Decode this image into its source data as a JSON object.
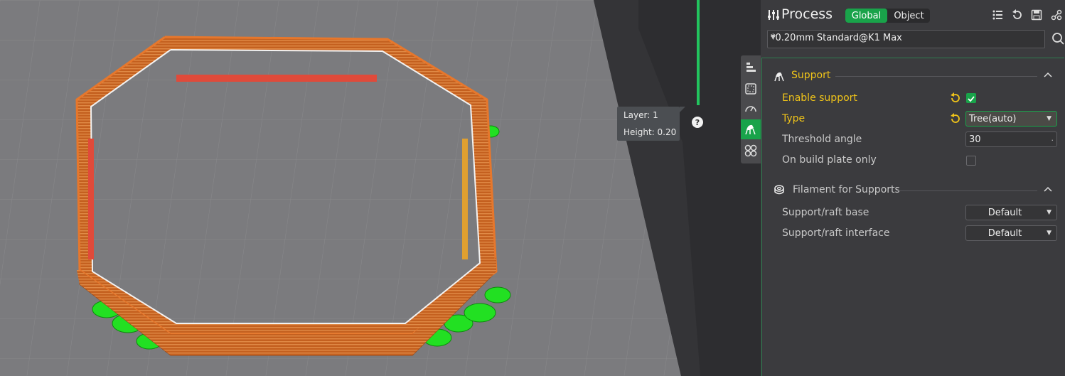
{
  "viewport": {
    "layer_label": "Layer: 1",
    "height_label": "Height: 0.20",
    "help_label": "?"
  },
  "sidetabs": [
    {
      "icon": "quality-icon"
    },
    {
      "icon": "strength-icon"
    },
    {
      "icon": "speed-icon"
    },
    {
      "icon": "support-icon",
      "active": true
    },
    {
      "icon": "others-icon"
    }
  ],
  "panel": {
    "title": "Process",
    "mode_global": "Global",
    "mode_object": "Object",
    "preset": "*0.20mm Standard@K1 Max",
    "sections": {
      "support": {
        "title": "Support",
        "enable_support_label": "Enable support",
        "type_label": "Type",
        "type_value": "Tree(auto)",
        "threshold_label": "Threshold angle",
        "threshold_value": "30",
        "threshold_unit": ".",
        "build_plate_label": "On build plate only"
      },
      "filament": {
        "title": "Filament for Supports",
        "base_label": "Support/raft base",
        "base_value": "Default",
        "interface_label": "Support/raft interface",
        "interface_value": "Default"
      }
    }
  },
  "colors": {
    "accent": "#19a34a",
    "changed": "#f0c419",
    "model": "#cf6a24",
    "support": "#22e022"
  }
}
